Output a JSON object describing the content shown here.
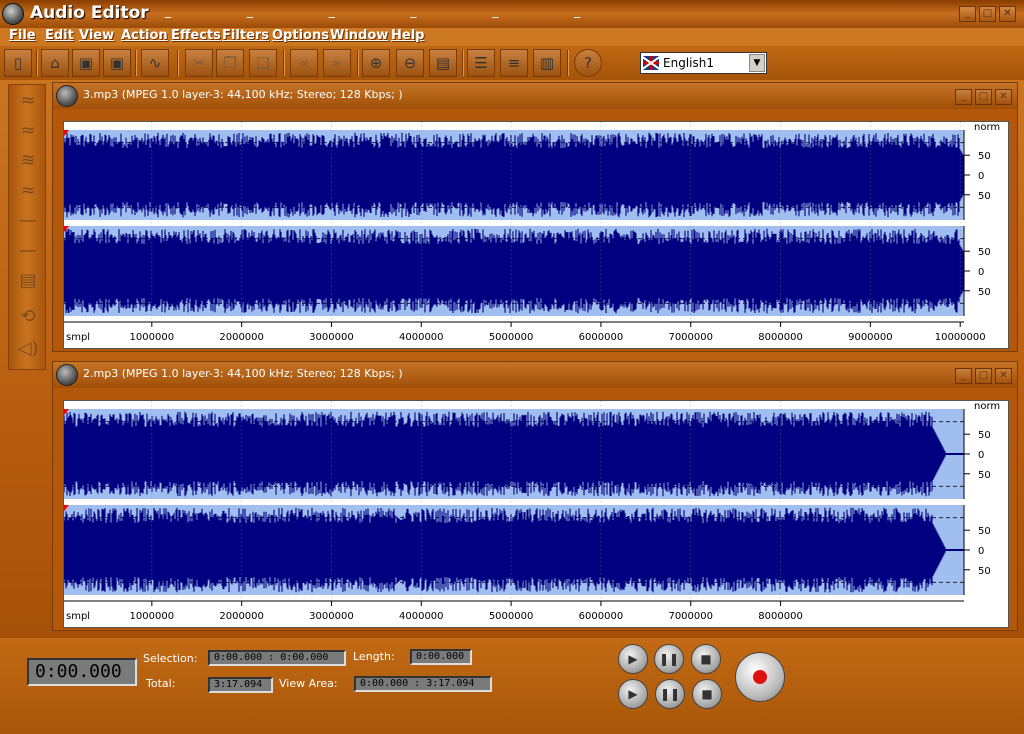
{
  "window": {
    "title": "Audio Editor",
    "dashes": "_ _ _ _ _ _"
  },
  "menu": [
    "File",
    "Edit",
    "View",
    "Action",
    "Effects",
    "Filters",
    "Options",
    "Window",
    "Help"
  ],
  "toolbar": {
    "language": "English1",
    "buttons": [
      "new-file-icon",
      "open-folder-icon",
      "save-icon",
      "save-as-icon",
      "waveform-icon",
      "cut-icon",
      "copy-icon",
      "paste-icon",
      "undo-icon",
      "redo-icon",
      "zoom-in-icon",
      "zoom-out-icon",
      "zoom-fit-icon",
      "cascade-icon",
      "tile-horizontal-icon",
      "tile-vertical-icon",
      "help-icon"
    ]
  },
  "panels": [
    {
      "title": "3.mp3 (MPEG 1.0 layer-3: 44,100 kHz; Stereo; 128 Kbps; )",
      "unit_label": "smpl",
      "scale_label": "norm",
      "x_ticks": [
        "1000000",
        "2000000",
        "3000000",
        "4000000",
        "5000000",
        "6000000",
        "7000000",
        "8000000",
        "9000000",
        "10000000"
      ],
      "y_ticks": [
        "50",
        "0",
        "50"
      ]
    },
    {
      "title": "2.mp3 (MPEG 1.0 layer-3: 44,100 kHz; Stereo; 128 Kbps; )",
      "unit_label": "smpl",
      "scale_label": "norm",
      "x_ticks": [
        "1000000",
        "2000000",
        "3000000",
        "4000000",
        "5000000",
        "6000000",
        "7000000",
        "8000000"
      ],
      "y_ticks": [
        "50",
        "0",
        "50"
      ]
    }
  ],
  "status": {
    "time": "0:00.000",
    "selection_label": "Selection:",
    "selection_value": "0:00.000 : 0:00.000",
    "length_label": "Length:",
    "length_value": "0:00.000",
    "total_label": "Total:",
    "total_value": "3:17.094",
    "view_area_label": "View Area:",
    "view_area_value": "0:00.000 : 3:17.094"
  },
  "colors": {
    "wave": "#000080",
    "wave_bg": "#a0bff0",
    "accent": "#c26a14"
  }
}
